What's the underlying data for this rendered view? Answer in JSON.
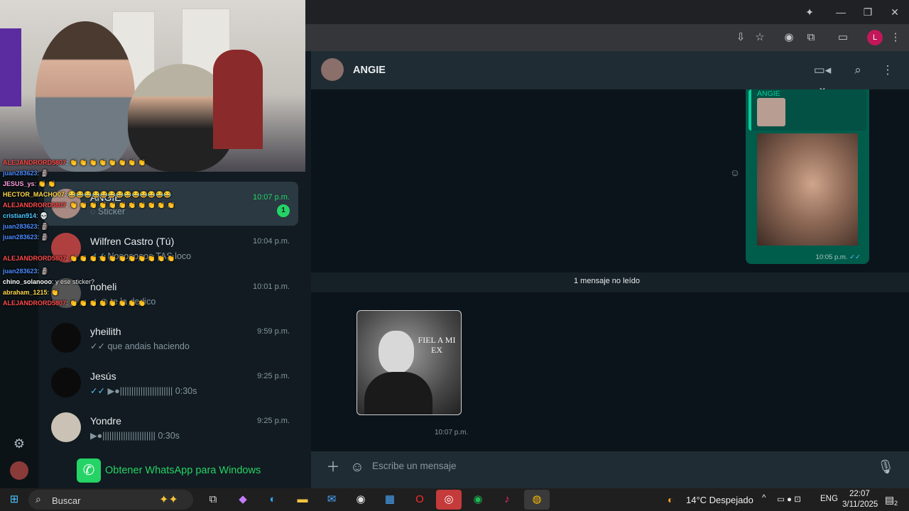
{
  "stream_chat": [
    {
      "user": "ALEJANDRORD5807",
      "msg": ": 👏 👏 👏 👏 👏 👏 👏 👏",
      "color": "#ff4b4b"
    },
    {
      "user": "juan283623",
      "msg": ": 🗿",
      "color": "#4b8bff"
    },
    {
      "user": "JESUS_ys",
      "msg": ": 👏 👏",
      "color": "#ff9ee0"
    },
    {
      "user": "HECTOR_MACHO07",
      "msg": ": 😂😂😂😂😂😂😂😂😂😂😂😂😂",
      "color": "#ffd84b"
    },
    {
      "user": "ALEJANDRORD5807",
      "msg": ": 👏 👏 👏 👏 👏 👏 👏 👏 👏 👏 👏",
      "color": "#ff4b4b"
    },
    {
      "user": "cristian914",
      "msg": ": 💀",
      "color": "#4bc8ff"
    },
    {
      "user": "juan283623",
      "msg": ": 🗿",
      "color": "#4b8bff"
    },
    {
      "user": "juan283623",
      "msg": ": 🗿",
      "color": "#4b8bff"
    },
    {
      "user": "juan283623",
      "msg": ": 🗿",
      "color": "#4b8bff"
    },
    {
      "user": "ALEJANDRORD5807",
      "msg": ": 👏 👏 👏 👏 👏 👏 👏 👏 👏 👏 👏",
      "color": "#ff4b4b"
    },
    {
      "user": "juan283623",
      "msg": ": 🗿",
      "color": "#4b8bff"
    },
    {
      "user": "chino_solanooo",
      "msg": ": y ese sticker?",
      "color": "#ffffff"
    },
    {
      "user": "abraham_1215",
      "msg": ": 👏",
      "color": "#ffd84b"
    },
    {
      "user": "ALEJANDRORD5807",
      "msg": ": 👏 👏 👏 👏 👏 👏 👏 👏",
      "color": "#ff4b4b"
    }
  ],
  "chats": [
    {
      "name": "ANGIE",
      "time": "10:07 p.m.",
      "last": "Sticker",
      "unread": "1",
      "active": true
    },
    {
      "name": "Wilfren Castro (Tú)",
      "time": "10:04 p.m.",
      "last": "Noooooooo TAS loco"
    },
    {
      "name": "noheli",
      "time": "10:01 p.m.",
      "last": "te la dedico"
    },
    {
      "name": "yheilith",
      "time": "9:59 p.m.",
      "last": "que andais haciendo"
    },
    {
      "name": "Jesús",
      "time": "9:25 p.m.",
      "last": "●||||||||||||||||||||||| 0:30s"
    },
    {
      "name": "Yondre",
      "time": "9:25 p.m.",
      "last": "●||||||||||||||||||||||| 0:30s"
    }
  ],
  "get_whatsapp": "Obtener WhatsApp para Windows",
  "conversation": {
    "contact": "ANGIE",
    "quote_name": "ANGIE",
    "outgoing_time": "10:05 p.m.",
    "unread_label": "1 mensaje no leído",
    "sticker_text": "FIEL A MI EX",
    "sticker_time": "10:07 p.m.",
    "composer_placeholder": "Escribe un mensaje"
  },
  "taskbar": {
    "search_placeholder": "Buscar",
    "weather": "14°C  Despejado",
    "lang": "ENG",
    "time": "22:07",
    "date": "3/11/2025",
    "notif_count": "2"
  },
  "profile_initial": "L",
  "colors": {
    "accent": "#25d366",
    "bubble_out": "#005c4b",
    "tick": "#53bdeb"
  }
}
